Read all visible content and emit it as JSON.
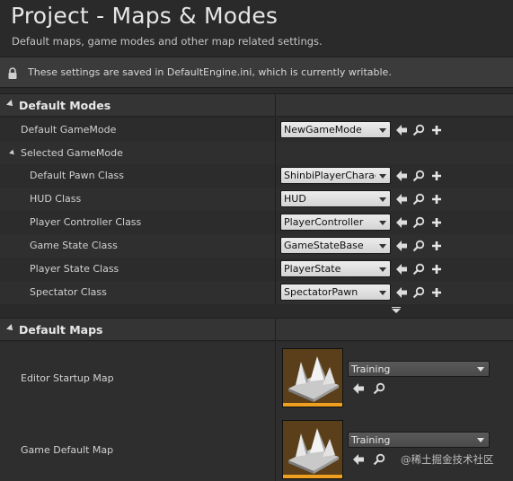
{
  "header": {
    "title": "Project - Maps & Modes",
    "subtitle": "Default maps, game modes and other map related settings."
  },
  "notice": {
    "text": "These settings are saved in DefaultEngine.ini, which is currently writable."
  },
  "default_modes": {
    "label": "Default Modes",
    "default_gamemode": {
      "label": "Default GameMode",
      "value": "NewGameMode"
    },
    "selected_gamemode_label": "Selected GameMode",
    "classes": [
      {
        "label": "Default Pawn Class",
        "value": "ShinbiPlayerCharacte"
      },
      {
        "label": "HUD Class",
        "value": "HUD"
      },
      {
        "label": "Player Controller Class",
        "value": "PlayerController"
      },
      {
        "label": "Game State Class",
        "value": "GameStateBase"
      },
      {
        "label": "Player State Class",
        "value": "PlayerState"
      },
      {
        "label": "Spectator Class",
        "value": "SpectatorPawn"
      }
    ]
  },
  "default_maps": {
    "label": "Default Maps",
    "editor_startup_map": {
      "label": "Editor Startup Map",
      "value": "Training"
    },
    "game_default_map": {
      "label": "Game Default Map",
      "value": "Training"
    }
  },
  "watermark": "@稀土掘金技术社区",
  "icons": [
    "lock-icon",
    "arrow-left-icon",
    "search-icon",
    "plus-icon",
    "chevron-down-icon",
    "map-thumbnail"
  ],
  "colors": {
    "accent": "#f0a020",
    "background": "#2a2a2a",
    "panel": "#343434"
  }
}
